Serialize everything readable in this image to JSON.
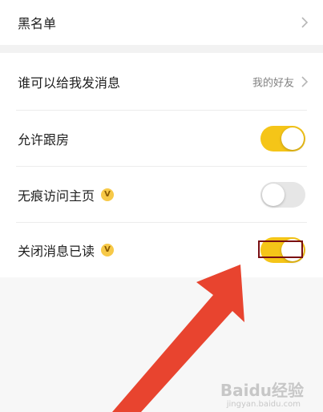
{
  "rows": [
    {
      "label": "黑名单"
    },
    {
      "label": "谁可以给我发消息",
      "value": "我的好友"
    },
    {
      "label": "允许跟房"
    },
    {
      "label": "无痕访问主页",
      "badge": "V"
    },
    {
      "label": "关闭消息已读",
      "badge": "V"
    }
  ],
  "toggles": {
    "allow_follow_room": "on",
    "invisible_visit": "off",
    "close_read_receipt": "on"
  },
  "colors": {
    "toggle_on": "#f5c518",
    "toggle_off": "#e6e6e6",
    "arrow": "#e8442f",
    "highlight_border": "#7a0f12"
  },
  "icons": [
    "chevron-right-icon",
    "vip-badge-icon",
    "arrow-annotation"
  ],
  "watermark": {
    "text": "Baidu经验",
    "sub": "jingyan.baidu.com"
  }
}
